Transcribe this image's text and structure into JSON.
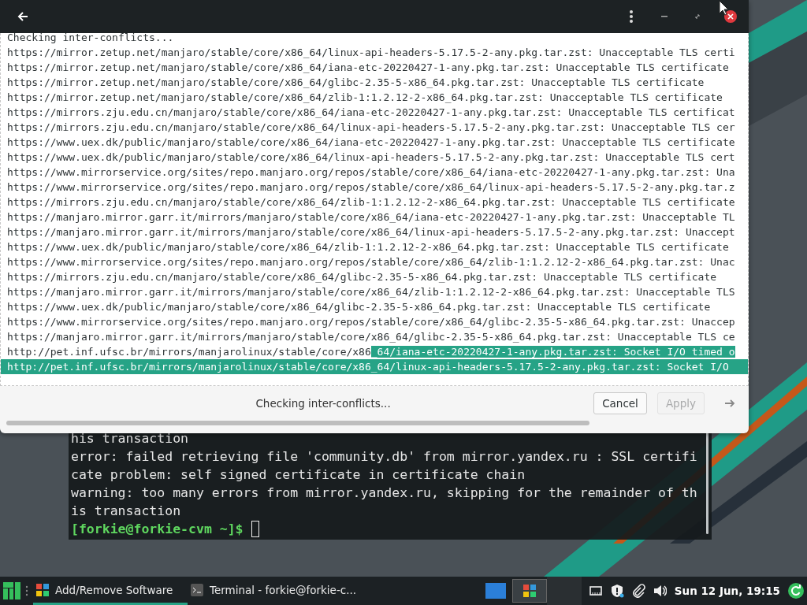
{
  "dialog": {
    "log_lines": [
      {
        "text": "Checking inter-conflicts..."
      },
      {
        "text": "https://mirror.zetup.net/manjaro/stable/core/x86_64/linux-api-headers-5.17.5-2-any.pkg.tar.zst: Unacceptable TLS certi"
      },
      {
        "text": "https://mirror.zetup.net/manjaro/stable/core/x86_64/iana-etc-20220427-1-any.pkg.tar.zst: Unacceptable TLS certificate"
      },
      {
        "text": "https://mirror.zetup.net/manjaro/stable/core/x86_64/glibc-2.35-5-x86_64.pkg.tar.zst: Unacceptable TLS certificate"
      },
      {
        "text": "https://mirror.zetup.net/manjaro/stable/core/x86_64/zlib-1:1.2.12-2-x86_64.pkg.tar.zst: Unacceptable TLS certificate"
      },
      {
        "text": "https://mirrors.zju.edu.cn/manjaro/stable/core/x86_64/iana-etc-20220427-1-any.pkg.tar.zst: Unacceptable TLS certificat"
      },
      {
        "text": "https://mirrors.zju.edu.cn/manjaro/stable/core/x86_64/linux-api-headers-5.17.5-2-any.pkg.tar.zst: Unacceptable TLS cer"
      },
      {
        "text": "https://www.uex.dk/public/manjaro/stable/core/x86_64/iana-etc-20220427-1-any.pkg.tar.zst: Unacceptable TLS certificate"
      },
      {
        "text": "https://www.uex.dk/public/manjaro/stable/core/x86_64/linux-api-headers-5.17.5-2-any.pkg.tar.zst: Unacceptable TLS cert"
      },
      {
        "text": "https://www.mirrorservice.org/sites/repo.manjaro.org/repos/stable/core/x86_64/iana-etc-20220427-1-any.pkg.tar.zst: Una"
      },
      {
        "text": "https://www.mirrorservice.org/sites/repo.manjaro.org/repos/stable/core/x86_64/linux-api-headers-5.17.5-2-any.pkg.tar.z"
      },
      {
        "text": "https://mirrors.zju.edu.cn/manjaro/stable/core/x86_64/zlib-1:1.2.12-2-x86_64.pkg.tar.zst: Unacceptable TLS certificate"
      },
      {
        "text": "https://manjaro.mirror.garr.it/mirrors/manjaro/stable/core/x86_64/iana-etc-20220427-1-any.pkg.tar.zst: Unacceptable TL"
      },
      {
        "text": "https://manjaro.mirror.garr.it/mirrors/manjaro/stable/core/x86_64/linux-api-headers-5.17.5-2-any.pkg.tar.zst: Unaccept"
      },
      {
        "text": "https://www.uex.dk/public/manjaro/stable/core/x86_64/zlib-1:1.2.12-2-x86_64.pkg.tar.zst: Unacceptable TLS certificate"
      },
      {
        "text": "https://www.mirrorservice.org/sites/repo.manjaro.org/repos/stable/core/x86_64/zlib-1:1.2.12-2-x86_64.pkg.tar.zst: Unac"
      },
      {
        "text": "https://mirrors.zju.edu.cn/manjaro/stable/core/x86_64/glibc-2.35-5-x86_64.pkg.tar.zst: Unacceptable TLS certificate"
      },
      {
        "text": "https://manjaro.mirror.garr.it/mirrors/manjaro/stable/core/x86_64/zlib-1:1.2.12-2-x86_64.pkg.tar.zst: Unacceptable TLS"
      },
      {
        "text": "https://www.uex.dk/public/manjaro/stable/core/x86_64/glibc-2.35-5-x86_64.pkg.tar.zst: Unacceptable TLS certificate"
      },
      {
        "text": "https://www.mirrorservice.org/sites/repo.manjaro.org/repos/stable/core/x86_64/glibc-2.35-5-x86_64.pkg.tar.zst: Unaccep"
      },
      {
        "text": "https://manjaro.mirror.garr.it/mirrors/manjaro/stable/core/x86_64/glibc-2.35-5-x86_64.pkg.tar.zst: Unacceptable TLS ce"
      },
      {
        "text": "http://pet.inf.ufsc.br/mirrors/manjarolinux/stable/core/x86",
        "selected_text": "_64/iana-etc-20220427-1-any.pkg.tar.zst: Socket I/O timed o"
      },
      {
        "selected_text": "http://pet.inf.ufsc.br/mirrors/manjarolinux/stable/core/x86_64/linux-api-headers-5.17.5-2-any.pkg.tar.zst: Socket I/O"
      }
    ],
    "status": "Checking inter-conflicts...",
    "buttons": [
      {
        "label": "Cancel",
        "disabled": false
      },
      {
        "label": "Apply",
        "disabled": true
      }
    ]
  },
  "terminal": {
    "lines": [
      "his transaction",
      "error: failed retrieving file 'community.db' from mirror.yandex.ru : SSL certifi",
      "cate problem: self signed certificate in certificate chain",
      "warning: too many errors from mirror.yandex.ru, skipping for the remainder of th",
      "is transaction"
    ],
    "prompt": "[forkie@forkie-cvm ~]$"
  },
  "taskbar": {
    "tasks": [
      {
        "label": "Add/Remove Software",
        "kind": "software",
        "selected": true
      },
      {
        "label": "Terminal - forkie@forkie-c...",
        "kind": "terminal",
        "selected": false
      }
    ],
    "clock": "Sun 12 Jun, 19:15"
  }
}
